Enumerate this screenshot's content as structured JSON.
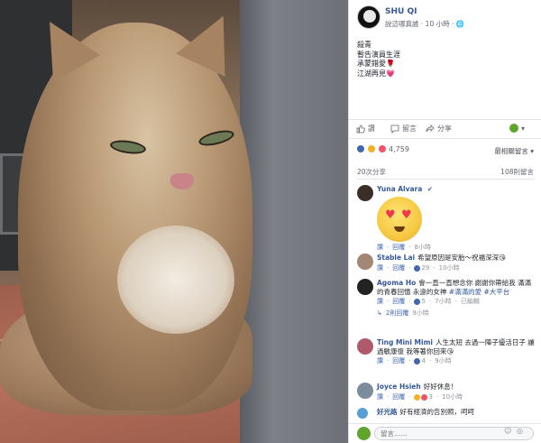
{
  "post": {
    "author": "SHU QI",
    "meta_prefix": "說這哪真誰 ·",
    "time": "10 小時 ·",
    "body_lines": [
      "殺青",
      "暫告演員生涯",
      "承蒙錯愛🌹",
      "江湖再見💗"
    ]
  },
  "actions": {
    "like": "讚",
    "comment": "留言",
    "share": "分享"
  },
  "reactions": {
    "count": "4,759",
    "sort_label": "最相關留言 ▾"
  },
  "stats": {
    "shares": "20次分享",
    "comments": "108則留言"
  },
  "comments": [
    {
      "name": "Yuna Alvara",
      "verified": true,
      "text": "",
      "has_sticker": true,
      "actions": [
        "讚",
        "回覆"
      ],
      "time": "8小時"
    },
    {
      "name": "Stable Lai",
      "text": "希望原因是安胎～祝福深深😘",
      "actions": [
        "讚",
        "回覆"
      ],
      "react_count": "29",
      "time": "10小時"
    },
    {
      "name": "Agoma Ho",
      "text_before": "會一直一直想念你 謝謝你帶給我 滿滿的青春回憶 永遠的女神",
      "hashtags": "#滿滿的愛 #大平台",
      "actions": [
        "讚",
        "回覆"
      ],
      "react_count": "5",
      "time": "7小時",
      "extra": "已編輯",
      "replies": "2則回覆",
      "replies_time": "9小時"
    },
    {
      "name": "Ting Mini Mimi",
      "text": "人生太短 去過一陣子優活日子 讓過敏康復 我等著你回來😘",
      "actions": [
        "讚",
        "回覆"
      ],
      "react_count": "4",
      "time": "9小時"
    },
    {
      "name": "Joyce Hsieh",
      "text": "好好休息！",
      "actions": [
        "讚",
        "回覆"
      ],
      "react_count": "3",
      "time": "10小時"
    },
    {
      "name": "好光路",
      "text": "好有經濟的告別照，呵呵",
      "actions": [],
      "time": ""
    }
  ],
  "composer": {
    "placeholder": "留言……"
  },
  "colors": {
    "link": "#365899",
    "accent": "#4267b2",
    "green": "#5fa52b"
  }
}
